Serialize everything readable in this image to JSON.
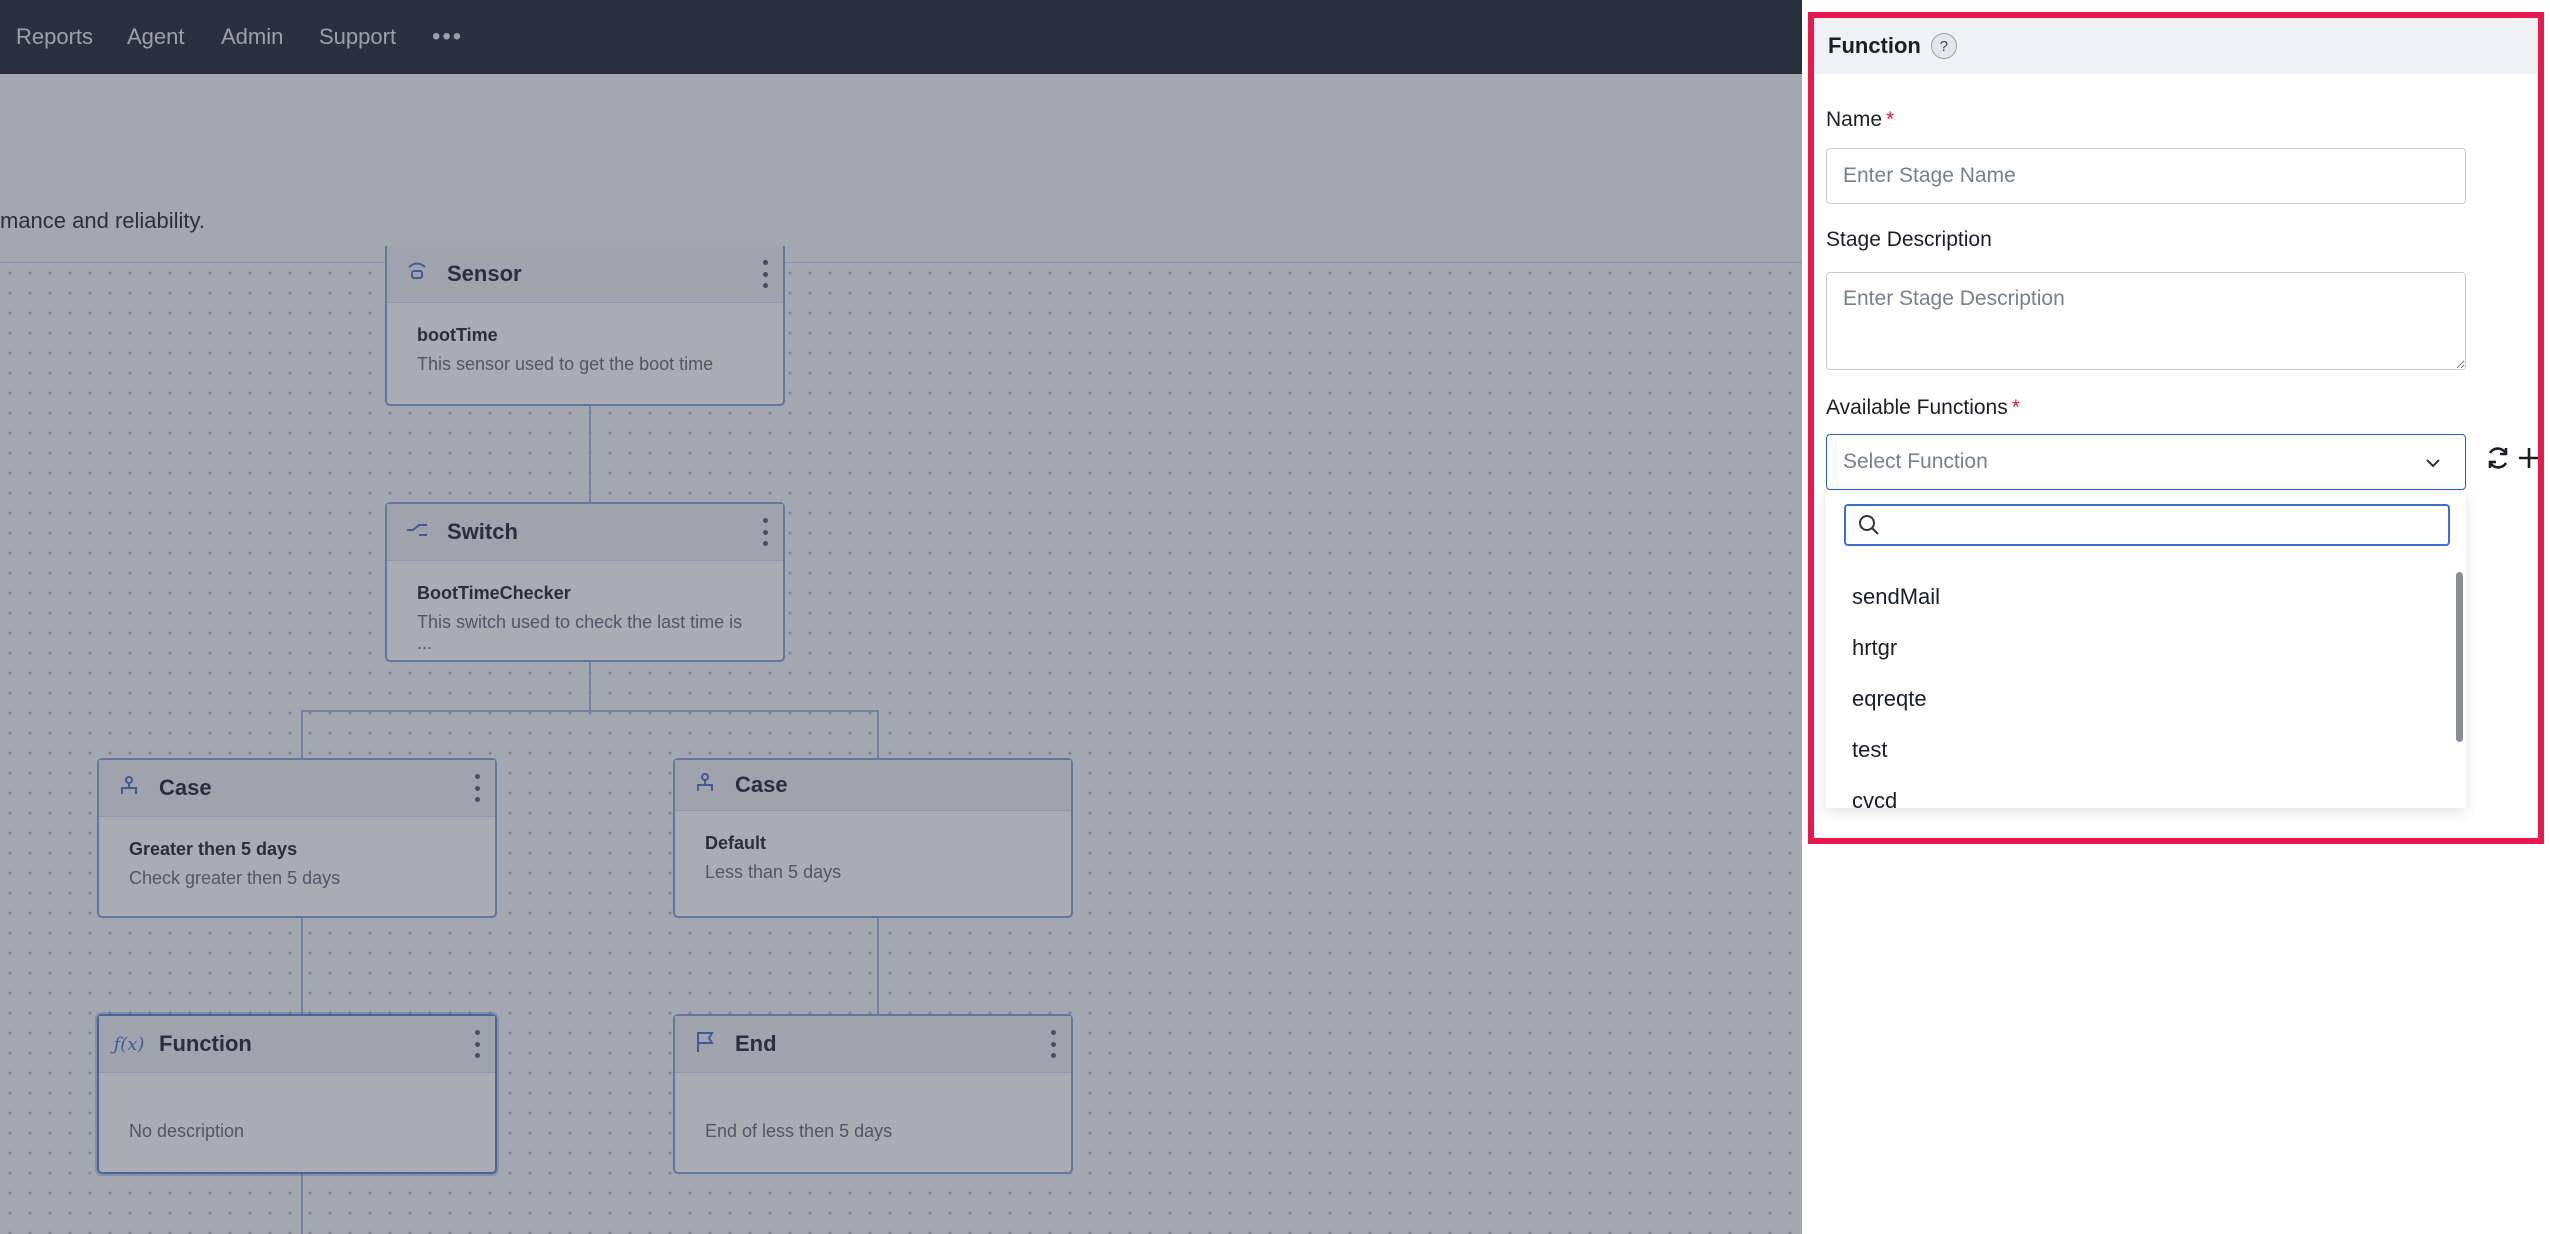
{
  "nav": {
    "items": [
      "Reports",
      "Agent",
      "Admin",
      "Support"
    ],
    "more": "•••"
  },
  "page": {
    "subtitle": "mance and reliability."
  },
  "workflow": {
    "nodes": [
      {
        "type": "Sensor",
        "name": "bootTime",
        "desc": "This sensor used to get the boot time",
        "icon": "sensor-icon"
      },
      {
        "type": "Switch",
        "name": "BootTimeChecker",
        "desc": "This switch used to check the last time is ...",
        "icon": "switch-icon"
      },
      {
        "type": "Case",
        "name": "Greater then 5 days",
        "desc": "Check greater then 5 days",
        "icon": "case-icon"
      },
      {
        "type": "Case",
        "name": "Default",
        "desc": "Less than 5 days",
        "icon": "case-icon"
      },
      {
        "type": "Function",
        "name": "",
        "desc": "No description",
        "icon": "function-icon"
      },
      {
        "type": "End",
        "name": "",
        "desc": "End of less then 5 days",
        "icon": "flag-icon"
      }
    ]
  },
  "panel": {
    "title": "Function",
    "help": "?",
    "name_label": "Name",
    "name_placeholder": "Enter Stage Name",
    "desc_label": "Stage Description",
    "desc_placeholder": "Enter Stage Description",
    "functions_label": "Available Functions",
    "required_mark": "*",
    "select_placeholder": "Select Function",
    "options": [
      "sendMail",
      "hrtgr",
      "eqreqte",
      "test",
      "cvcd"
    ]
  },
  "colors": {
    "accent": "#2d5fb8",
    "highlight": "#e8174e",
    "required": "#e0174a"
  }
}
